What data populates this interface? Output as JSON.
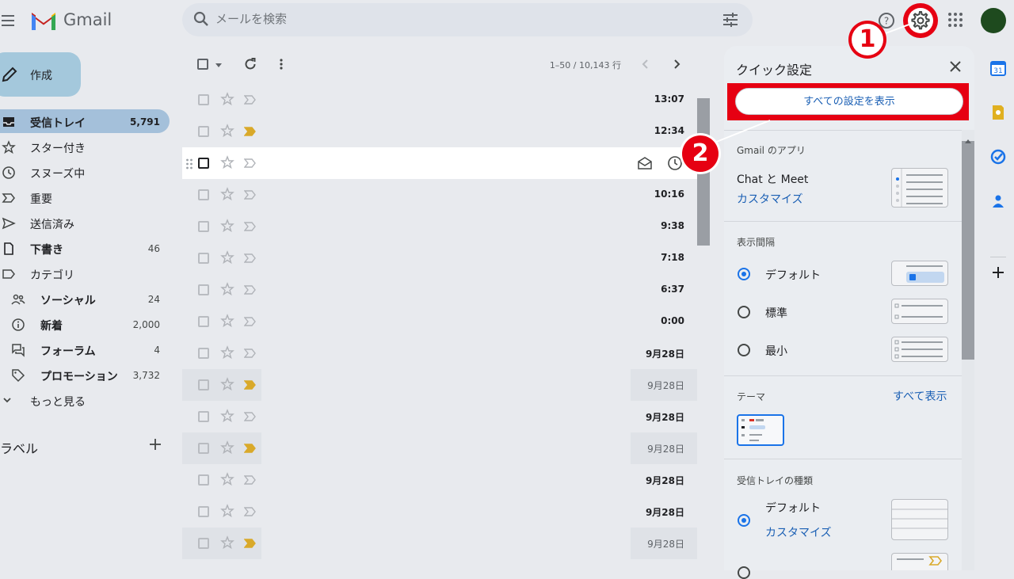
{
  "header": {
    "brand": "Gmail",
    "search_placeholder": "メールを検索"
  },
  "sidebar": {
    "compose": "作成",
    "items": [
      {
        "label": "受信トレイ",
        "count": "5,791",
        "bold": true,
        "active": true,
        "icon": "inbox-icon"
      },
      {
        "label": "スター付き",
        "count": "",
        "bold": false,
        "icon": "star-icon"
      },
      {
        "label": "スヌーズ中",
        "count": "",
        "bold": false,
        "icon": "clock-icon"
      },
      {
        "label": "重要",
        "count": "",
        "bold": false,
        "icon": "label-important-icon"
      },
      {
        "label": "送信済み",
        "count": "",
        "bold": false,
        "icon": "send-icon"
      },
      {
        "label": "下書き",
        "count": "46",
        "bold": true,
        "icon": "draft-icon"
      },
      {
        "label": "カテゴリ",
        "count": "",
        "bold": false,
        "icon": "label-icon"
      }
    ],
    "categories": [
      {
        "label": "ソーシャル",
        "count": "24",
        "icon": "people-icon"
      },
      {
        "label": "新着",
        "count": "2,000",
        "icon": "info-icon"
      },
      {
        "label": "フォーラム",
        "count": "4",
        "icon": "forum-icon"
      },
      {
        "label": "プロモーション",
        "count": "3,732",
        "icon": "tag-icon"
      }
    ],
    "more": "もっと見る",
    "labels_title": "ラベル"
  },
  "mail_list": {
    "pager": "1–50 / 10,143 行",
    "rows": [
      {
        "time": "13:07",
        "unread": true,
        "important": false
      },
      {
        "time": "12:34",
        "unread": true,
        "important": true
      },
      {
        "time": "",
        "unread": true,
        "important": false,
        "hover": true
      },
      {
        "time": "10:16",
        "unread": true,
        "important": false
      },
      {
        "time": "9:38",
        "unread": true,
        "important": false
      },
      {
        "time": "7:18",
        "unread": true,
        "important": false
      },
      {
        "time": "6:37",
        "unread": true,
        "important": false
      },
      {
        "time": "0:00",
        "unread": true,
        "important": false
      },
      {
        "time": "9月28日",
        "unread": true,
        "important": false
      },
      {
        "time": "9月28日",
        "unread": false,
        "important": true
      },
      {
        "time": "9月28日",
        "unread": true,
        "important": false
      },
      {
        "time": "9月28日",
        "unread": false,
        "important": true
      },
      {
        "time": "9月28日",
        "unread": true,
        "important": false
      },
      {
        "time": "9月28日",
        "unread": true,
        "important": false
      },
      {
        "time": "9月28日",
        "unread": false,
        "important": true
      }
    ]
  },
  "quick_settings": {
    "title": "クイック設定",
    "all_settings_button": "すべての設定を表示",
    "apps_section": "Gmail のアプリ",
    "chat_meet": "Chat と Meet",
    "customize": "カスタマイズ",
    "density_section": "表示間隔",
    "density_options": [
      {
        "label": "デフォルト",
        "selected": true
      },
      {
        "label": "標準",
        "selected": false
      },
      {
        "label": "最小",
        "selected": false
      }
    ],
    "theme_section": "テーマ",
    "theme_view_all": "すべて表示",
    "inbox_type_section": "受信トレイの種類",
    "inbox_default": "デフォルト",
    "inbox_customize": "カスタマイズ"
  },
  "annotations": {
    "step1": "1",
    "step2": "2"
  },
  "colors": {
    "annotation_red": "#e60012",
    "link_blue": "#1a5fb4",
    "important_yellow": "#d9a92a"
  }
}
